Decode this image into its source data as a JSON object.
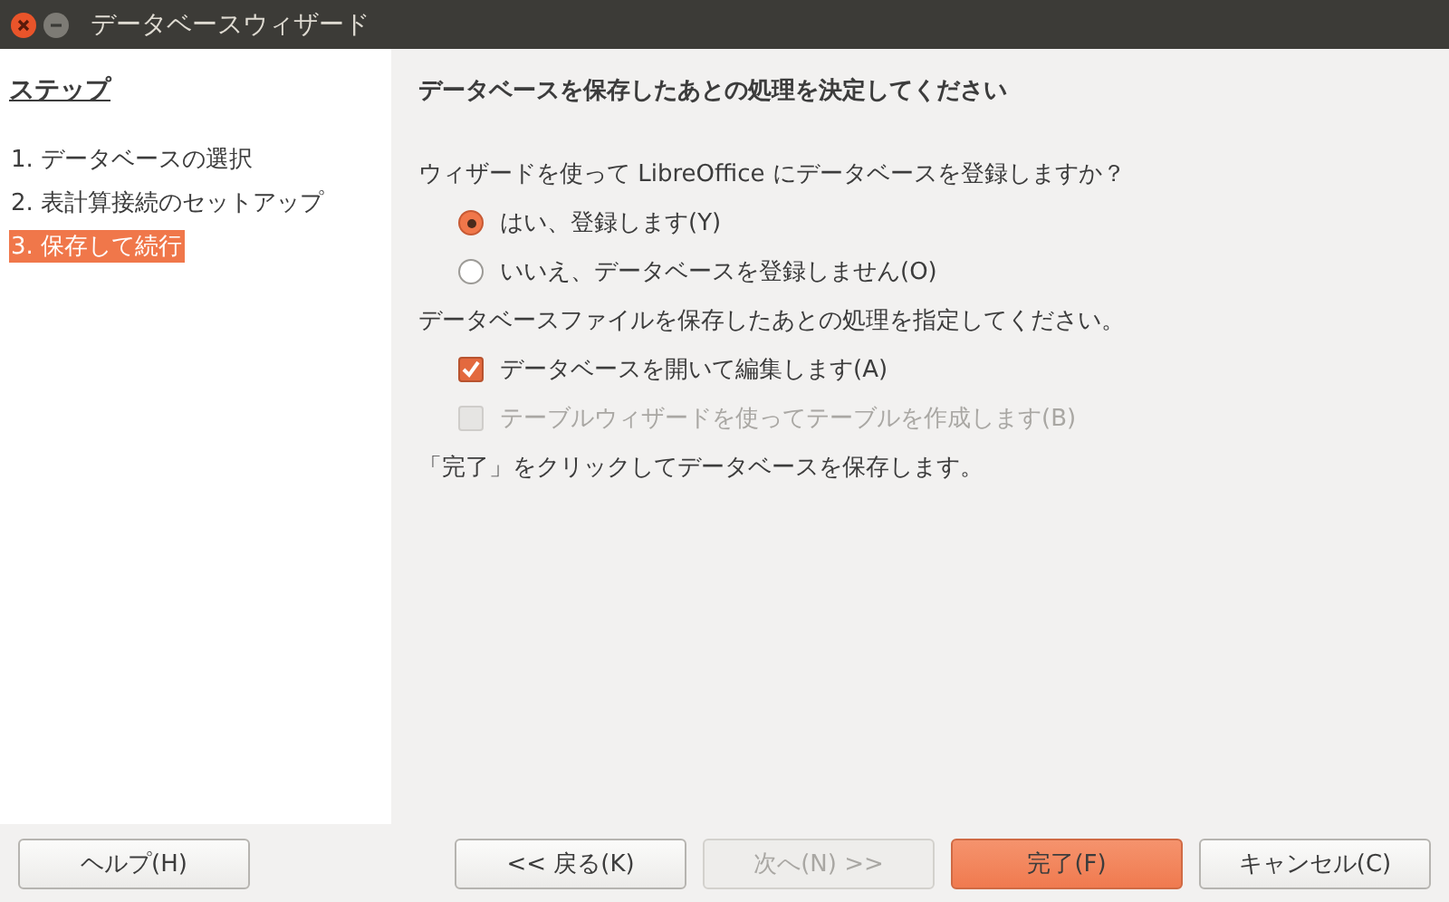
{
  "window": {
    "title": "データベースウィザード"
  },
  "steps": {
    "heading": "ステップ",
    "items": [
      {
        "label": "1. データベースの選択",
        "selected": false
      },
      {
        "label": "2. 表計算接続のセットアップ",
        "selected": false
      },
      {
        "label": "3. 保存して続行",
        "selected": true
      }
    ]
  },
  "page": {
    "heading": "データベースを保存したあとの処理を決定してください",
    "question": "ウィザードを使って LibreOffice にデータベースを登録しますか？",
    "radios": [
      {
        "label": "はい、登録します(Y)",
        "selected": true
      },
      {
        "label": "いいえ、データベースを登録しません(O)",
        "selected": false
      }
    ],
    "instruction": "データベースファイルを保存したあとの処理を指定してください。",
    "checkboxes": [
      {
        "label": "データベースを開いて編集します(A)",
        "checked": true,
        "disabled": false
      },
      {
        "label": "テーブルウィザードを使ってテーブルを作成します(B)",
        "checked": false,
        "disabled": true
      }
    ],
    "note": "「完了」をクリックしてデータベースを保存します。"
  },
  "buttons": [
    {
      "label": "ヘルプ(H)",
      "kind": "help",
      "disabled": false
    },
    {
      "label": "<< 戻る(K)",
      "kind": "back",
      "disabled": false
    },
    {
      "label": "次へ(N) >>",
      "kind": "next",
      "disabled": true
    },
    {
      "label": "完了(F)",
      "kind": "finish",
      "disabled": false
    },
    {
      "label": "キャンセル(C)",
      "kind": "cancel",
      "disabled": false
    }
  ]
}
